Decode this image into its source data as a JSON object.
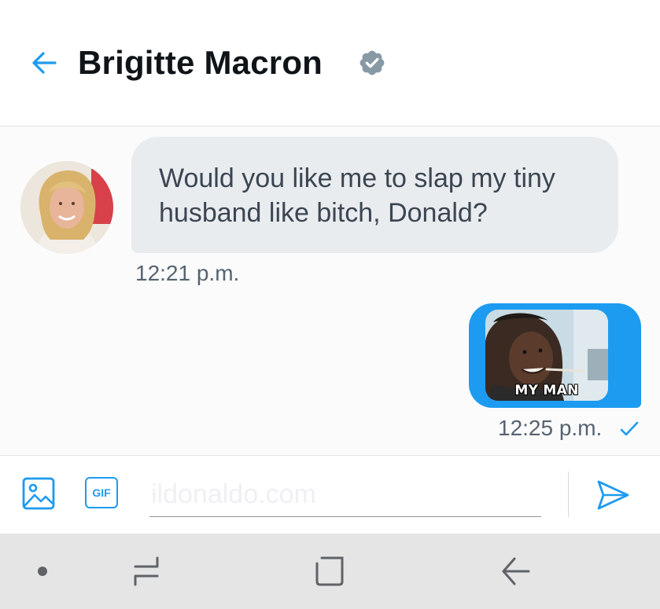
{
  "header": {
    "contact_name": "Brigitte Macron",
    "back_icon": "arrow-left-icon",
    "verified_icon": "verified-badge-icon"
  },
  "messages": [
    {
      "direction": "incoming",
      "text": "Would you like me to slap my tiny husband like bitch, Donald?",
      "time": "12:21 p.m."
    },
    {
      "direction": "outgoing",
      "type": "gif",
      "gif_caption": "MY MAN",
      "time": "12:25 p.m.",
      "status_icon": "check-icon"
    }
  ],
  "composer": {
    "placeholder": "ildonaldo.com",
    "image_icon": "image-icon",
    "gif_label": "GIF",
    "send_icon": "send-icon"
  },
  "navbar": {
    "items": [
      "dot-icon",
      "recent-apps-icon",
      "home-icon",
      "back-icon"
    ]
  },
  "colors": {
    "accent": "#1d9bf0",
    "incoming_bubble": "#e9ecef",
    "title_text": "#0f1419",
    "meta_text": "#566370",
    "verified_badge": "#8899a6",
    "navbar_bg": "#e5e5e5"
  }
}
